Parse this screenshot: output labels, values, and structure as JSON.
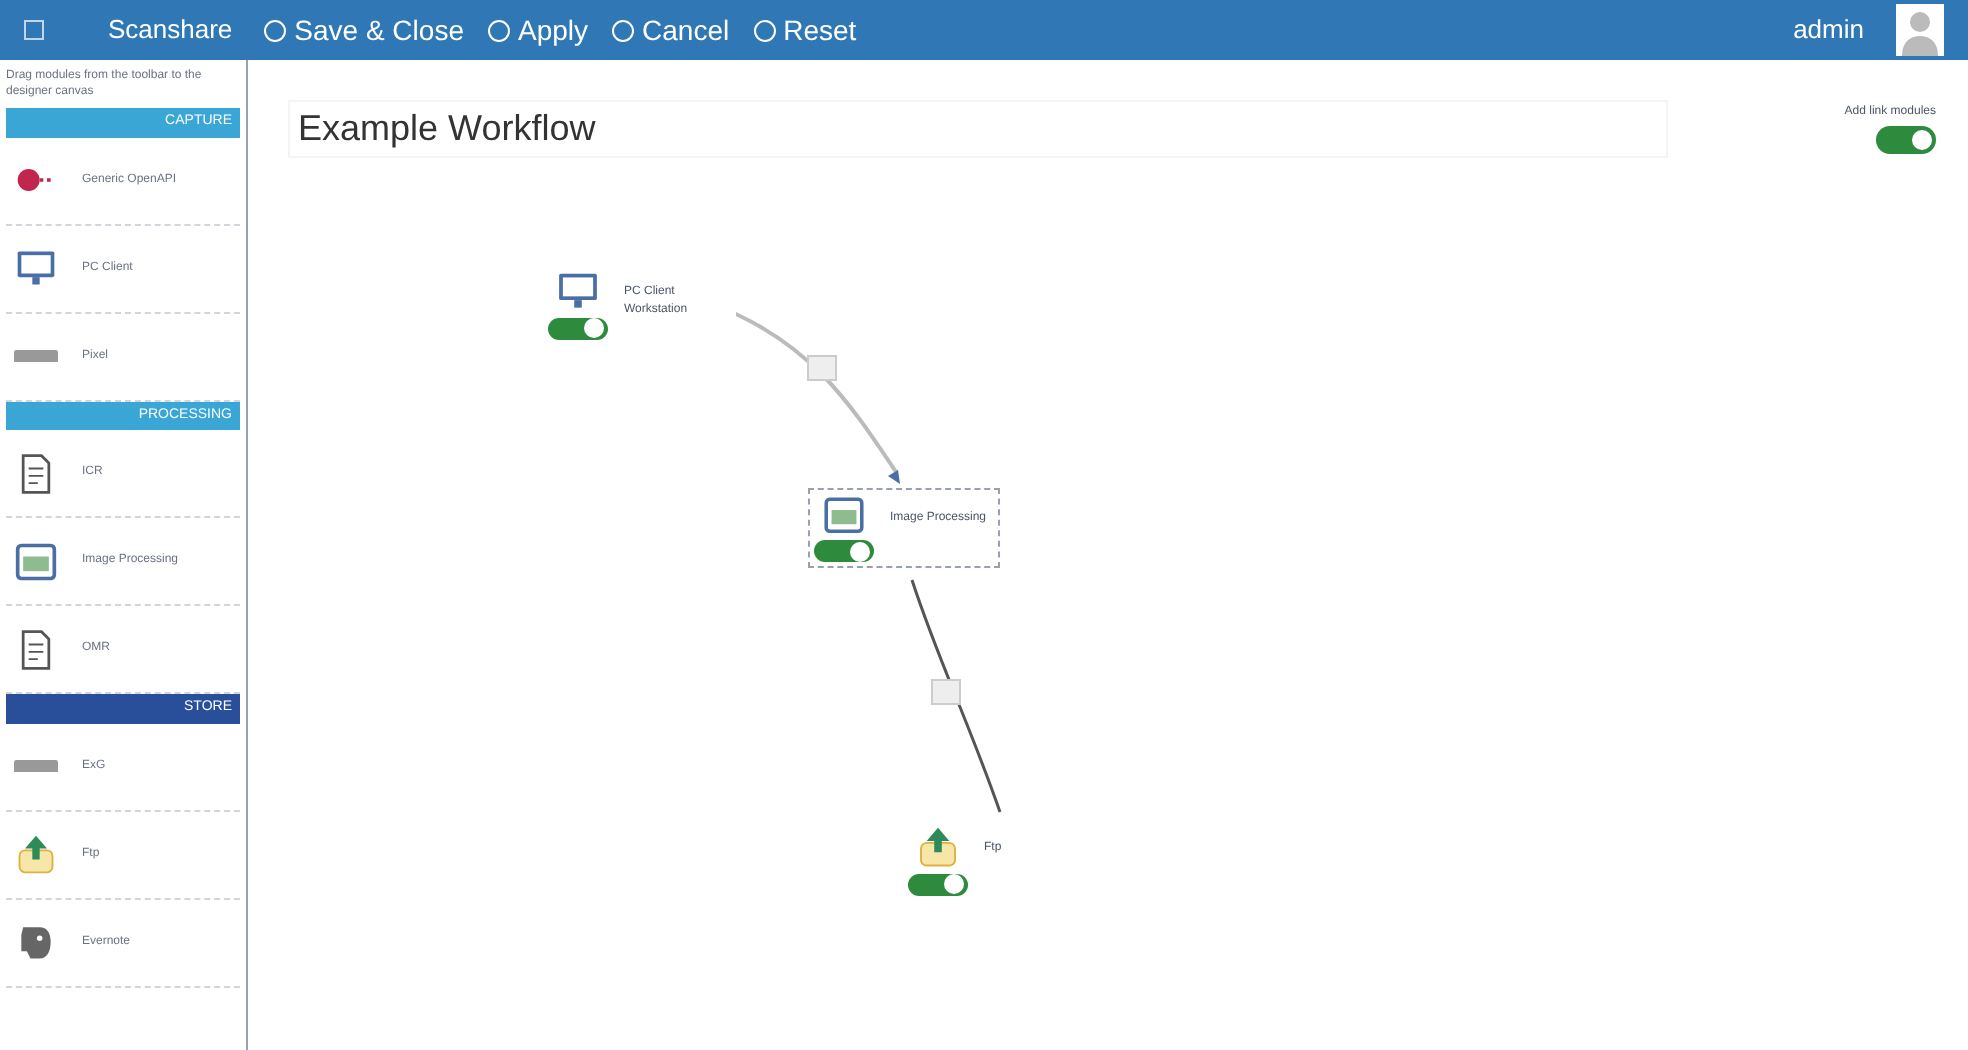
{
  "header": {
    "brand": "Scanshare",
    "actions": [
      "Save & Close",
      "Apply",
      "Cancel",
      "Reset"
    ],
    "user": "admin"
  },
  "toolbox": {
    "hint": "Drag modules from the toolbar to the designer canvas",
    "sections": [
      {
        "title": "CAPTURE",
        "modules": [
          {
            "kind": "api",
            "label": "Generic OpenAPI"
          },
          {
            "kind": "pc",
            "label": "PC Client"
          },
          {
            "kind": "text",
            "label": "Pixel"
          }
        ]
      },
      {
        "title": "PROCESSING",
        "modules": [
          {
            "kind": "doc",
            "label": "ICR"
          },
          {
            "kind": "image",
            "label": "Image Processing"
          },
          {
            "kind": "doc",
            "label": "OMR"
          }
        ]
      },
      {
        "title": "STORE",
        "modules": [
          {
            "kind": "text",
            "label": "ExG"
          },
          {
            "kind": "upload",
            "label": "Ftp"
          },
          {
            "kind": "elephant",
            "label": "Evernote"
          }
        ]
      }
    ]
  },
  "workflow": {
    "title": "Example Workflow",
    "link_modules": {
      "label": "Add link modules",
      "on": true
    },
    "nodes": [
      {
        "kind": "pc",
        "label": "PC Client Workstation",
        "enabled": true
      },
      {
        "kind": "image",
        "label": "Image Processing",
        "enabled": true
      },
      {
        "kind": "upload",
        "label": "Ftp",
        "enabled": true
      }
    ]
  }
}
